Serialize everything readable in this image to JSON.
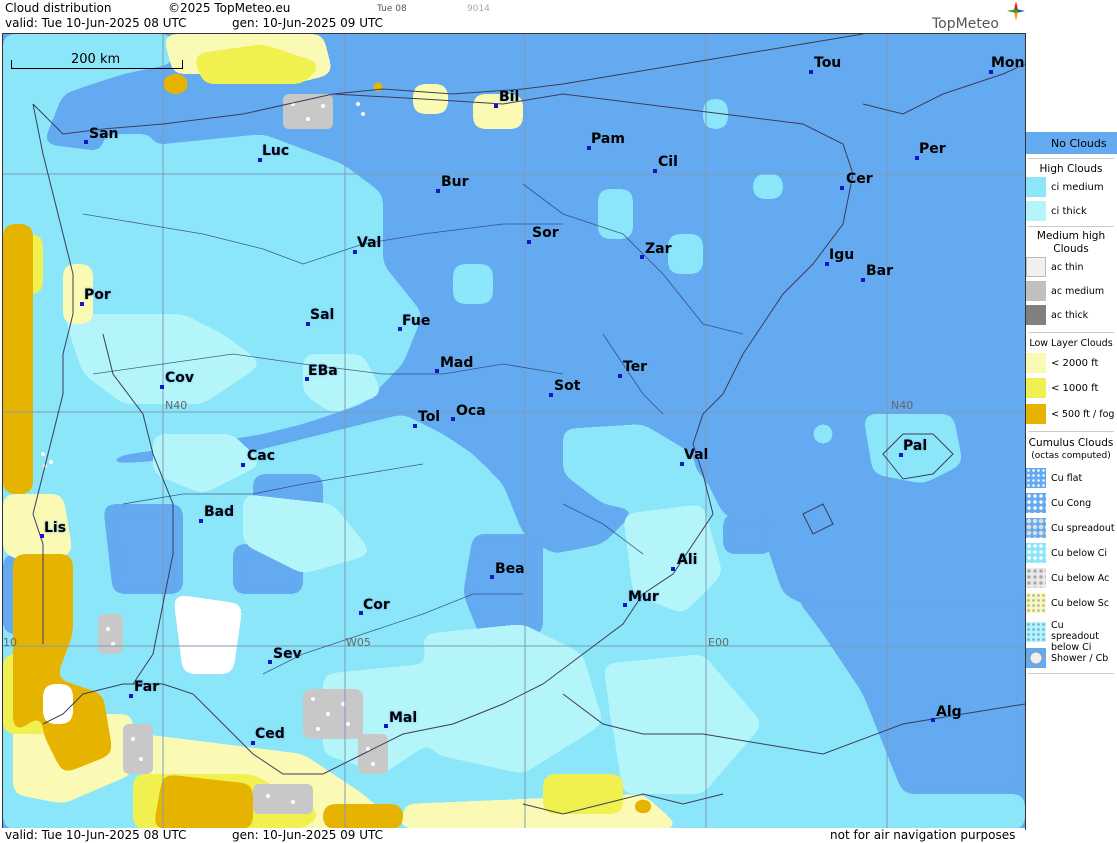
{
  "header": {
    "title": "Cloud distribution",
    "copyright": "©2025 TopMeteo.eu",
    "day_code": "Tue 08",
    "code": "9014",
    "valid": "valid:  Tue  10-Jun-2025  08 UTC",
    "gen": "gen: 10-Jun-2025 09 UTC",
    "logo": "TopMeteo"
  },
  "map": {
    "scale_label": "200 km",
    "grid_labels": [
      "N40",
      "N40",
      "W05",
      "E00",
      "10"
    ],
    "cities": [
      {
        "name": "Tou"
      },
      {
        "name": "Mon"
      },
      {
        "name": "Bil"
      },
      {
        "name": "San"
      },
      {
        "name": "Luc"
      },
      {
        "name": "Pam"
      },
      {
        "name": "Cil"
      },
      {
        "name": "Per"
      },
      {
        "name": "Bur"
      },
      {
        "name": "Cer"
      },
      {
        "name": "Val"
      },
      {
        "name": "Sor"
      },
      {
        "name": "Zar"
      },
      {
        "name": "Igu"
      },
      {
        "name": "Bar"
      },
      {
        "name": "Por"
      },
      {
        "name": "Sal"
      },
      {
        "name": "Fue"
      },
      {
        "name": "Mad"
      },
      {
        "name": "Ter"
      },
      {
        "name": "Cov"
      },
      {
        "name": "EBa"
      },
      {
        "name": "Sot"
      },
      {
        "name": "Tol"
      },
      {
        "name": "Oca"
      },
      {
        "name": "Pal"
      },
      {
        "name": "Cac"
      },
      {
        "name": "Val"
      },
      {
        "name": "Bad"
      },
      {
        "name": "Lis"
      },
      {
        "name": "Ali"
      },
      {
        "name": "Bea"
      },
      {
        "name": "Mur"
      },
      {
        "name": "Cor"
      },
      {
        "name": "Sev"
      },
      {
        "name": "Far"
      },
      {
        "name": "Alg"
      },
      {
        "name": "Mal"
      },
      {
        "name": "Ced"
      }
    ]
  },
  "footer": {
    "valid": "valid:  Tue  10-Jun-2025  08 UTC",
    "gen": "gen: 10-Jun-2025 09 UTC",
    "disclaimer": "not for air navigation purposes"
  },
  "legend": {
    "no_clouds": "No Clouds",
    "high_title": "High Clouds",
    "ci_medium": "ci medium",
    "ci_thick": "ci thick",
    "medium_title": "Medium high Clouds",
    "ac_thin": "ac thin",
    "ac_medium": "ac medium",
    "ac_thick": "ac thick",
    "low_title": "Low Layer Clouds",
    "low_2000": "< 2000 ft",
    "low_1000": "< 1000 ft",
    "low_500": "< 500 ft / fog",
    "cu_title": "Cumulus Clouds",
    "cu_sub": "(octas computed)",
    "cu_flat": "Cu flat",
    "cu_cong": "Cu Cong",
    "cu_spread": "Cu spreadout",
    "cu_below_ci": "Cu below Ci",
    "cu_below_ac": "Cu below Ac",
    "cu_below_sc": "Cu below Sc",
    "cu_spread_ci": "Cu spreadout below Ci",
    "shower": "Shower / Cb"
  },
  "colors": {
    "no_clouds": "#64aaf0",
    "ci_medium": "#8ce6fa",
    "ci_thick": "#b4f5fa",
    "low_2000": "#fafab4",
    "low_1000": "#f0f050",
    "low_500": "#e6b400"
  }
}
